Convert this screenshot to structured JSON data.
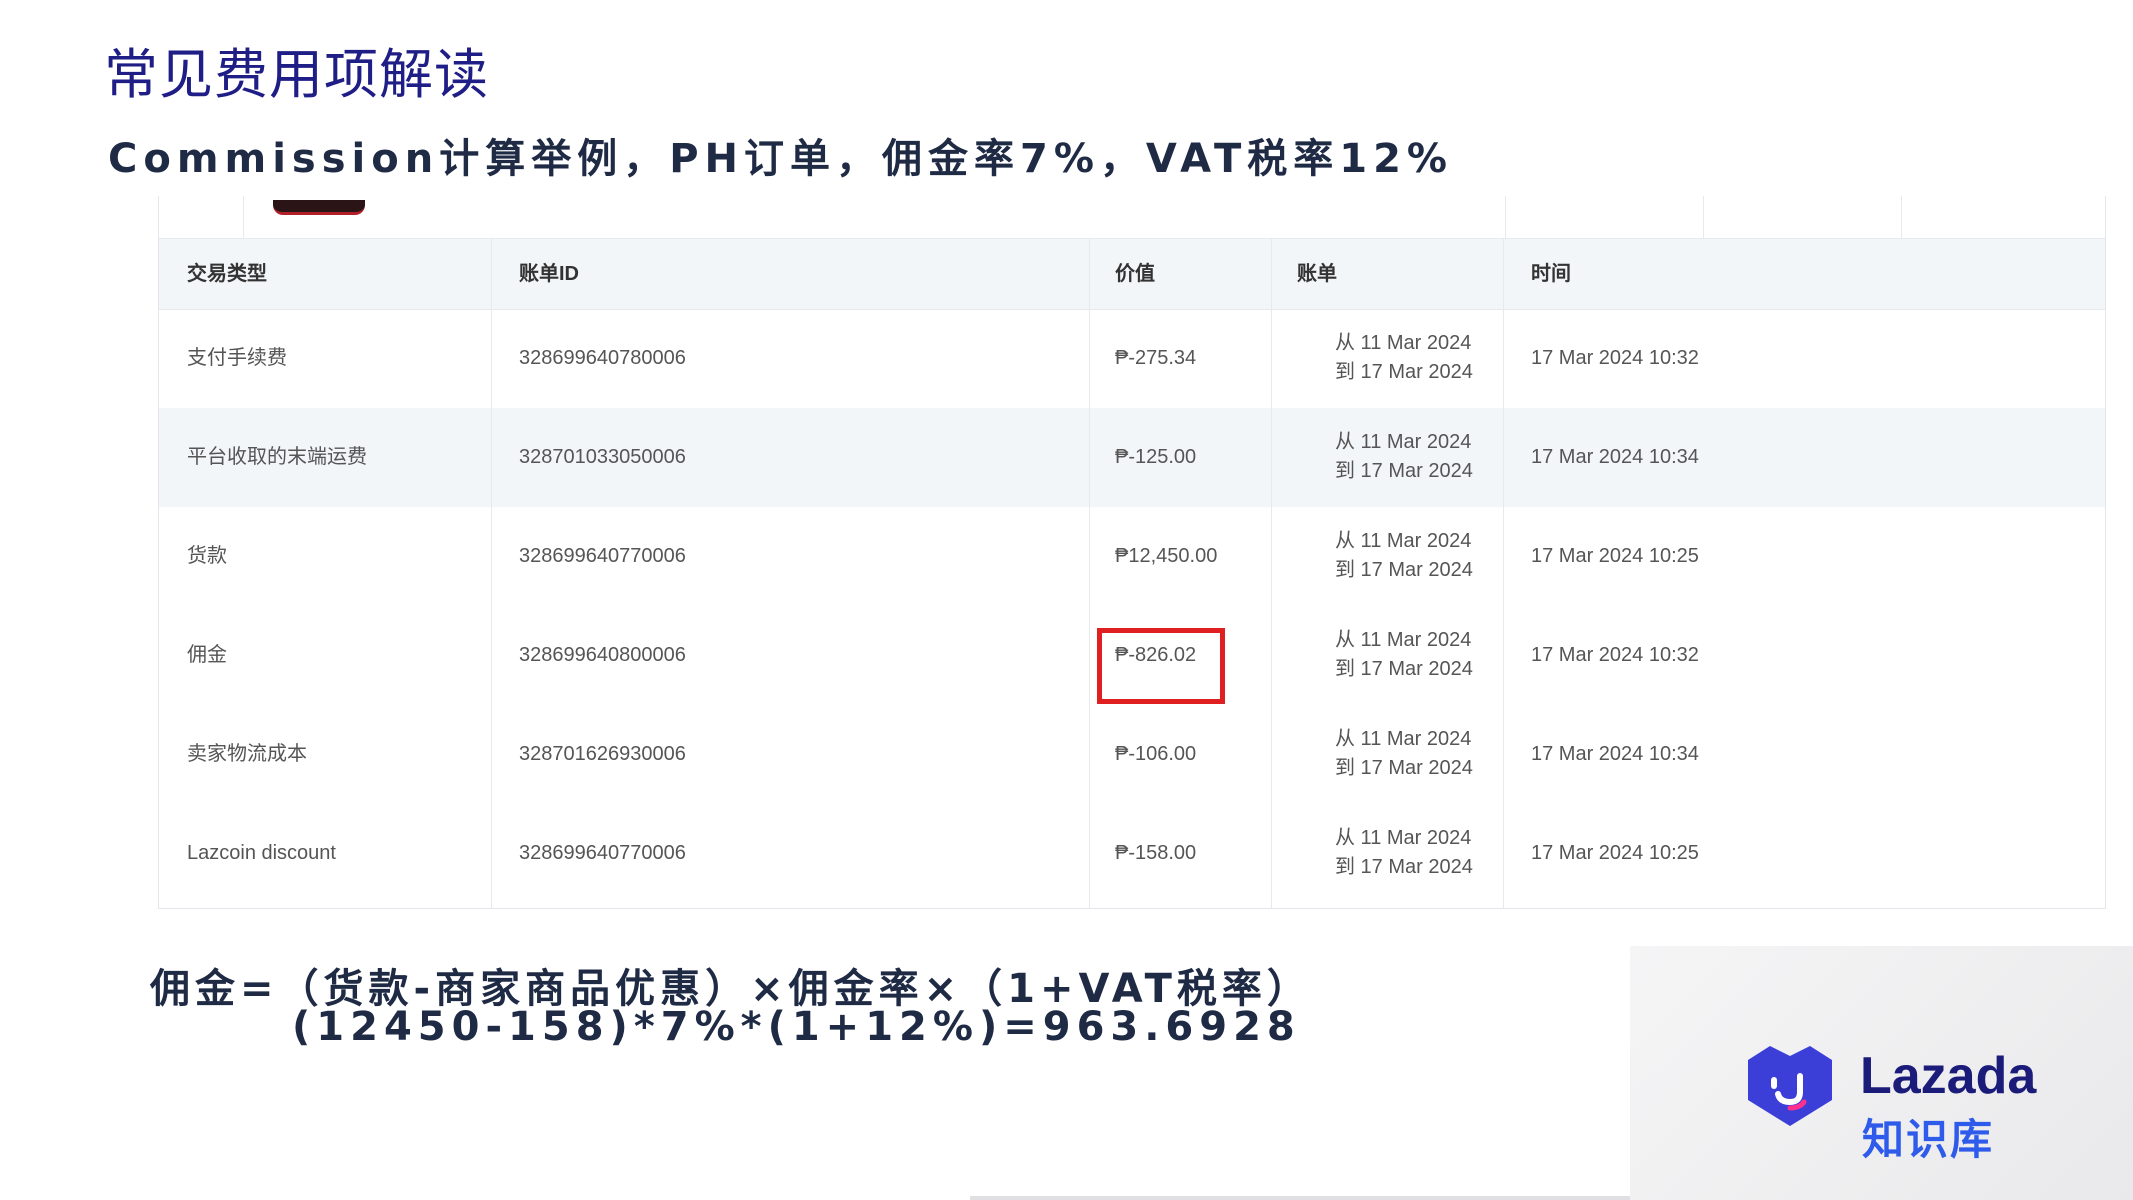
{
  "slide": {
    "title": "常见费用项解读",
    "subtitle": "Commission计算举例，PH订单，佣金率7%，VAT税率12%"
  },
  "table": {
    "headers": [
      "交易类型",
      "账单ID",
      "价值",
      "账单",
      "时间"
    ],
    "rows": [
      {
        "type": "支付手续费",
        "bill_id": "328699640780006",
        "value": "₱-275.34",
        "from": "从 11 Mar 2024",
        "to": "到 17 Mar 2024",
        "time": "17 Mar 2024 10:32"
      },
      {
        "type": "平台收取的末端运费",
        "bill_id": "328701033050006",
        "value": "₱-125.00",
        "from": "从 11 Mar 2024",
        "to": "到 17 Mar 2024",
        "time": "17 Mar 2024 10:34"
      },
      {
        "type": "货款",
        "bill_id": "328699640770006",
        "value": "₱12,450.00",
        "from": "从 11 Mar 2024",
        "to": "到 17 Mar 2024",
        "time": "17 Mar 2024 10:25"
      },
      {
        "type": "佣金",
        "bill_id": "328699640800006",
        "value": "₱-826.02",
        "from": "从 11 Mar 2024",
        "to": "到 17 Mar 2024",
        "time": "17 Mar 2024 10:32"
      },
      {
        "type": "卖家物流成本",
        "bill_id": "328701626930006",
        "value": "₱-106.00",
        "from": "从 11 Mar 2024",
        "to": "到 17 Mar 2024",
        "time": "17 Mar 2024 10:34"
      },
      {
        "type": "Lazcoin discount",
        "bill_id": "328699640770006",
        "value": "₱-158.00",
        "from": "从 11 Mar 2024",
        "to": "到 17 Mar 2024",
        "time": "17 Mar 2024 10:25"
      }
    ]
  },
  "formula": {
    "line1": "佣金=（货款-商家商品优惠）×佣金率×（1+VAT税率）",
    "line2": "(12450-158)*7%*(1+12%)=963.6928"
  },
  "brand": {
    "name": "Lazada",
    "sub": "知识库",
    "logo_icon": "lazada-heart-icon",
    "colors": {
      "primary": "#1b1b7a",
      "accent": "#2f5bea",
      "logo": "#3b3fd8"
    }
  },
  "colors": {
    "highlight": "#e02020",
    "title": "#1f1d86"
  }
}
